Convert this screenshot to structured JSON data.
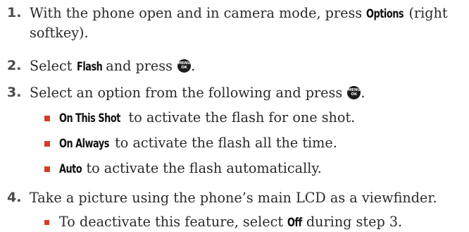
{
  "steps": [
    {
      "number": "1.",
      "line1_before": "With the phone open and in camera mode, press ",
      "line1_bold": "Options",
      "line1_after": " (right",
      "line2": "softkey)."
    },
    {
      "number": "2.",
      "before": "Select ",
      "bold": "Flash",
      "after": " and press ",
      "end": "."
    },
    {
      "number": "3.",
      "text": "Select an option from the following and press ",
      "end": "."
    },
    {
      "number": "4.",
      "text": "Take a picture using the phone’s main LCD as a viewfinder."
    }
  ],
  "options": [
    {
      "bold": "On This Shot",
      "text": " to activate the flash for one shot."
    },
    {
      "bold": "On Always",
      "text": " to activate the flash all the time."
    },
    {
      "bold": "Auto",
      "text": " to activate the flash automatically."
    }
  ],
  "note": {
    "before": "To deactivate this feature, select ",
    "bold": "Off",
    "after": " during step 3."
  },
  "menu_key": {
    "icon": "menu-ok-key-icon",
    "top": "MENU",
    "bottom": "OK"
  },
  "colors": {
    "bullet": "#d73b26",
    "text": "#2a2a2a",
    "key": "#1c1c1c"
  }
}
